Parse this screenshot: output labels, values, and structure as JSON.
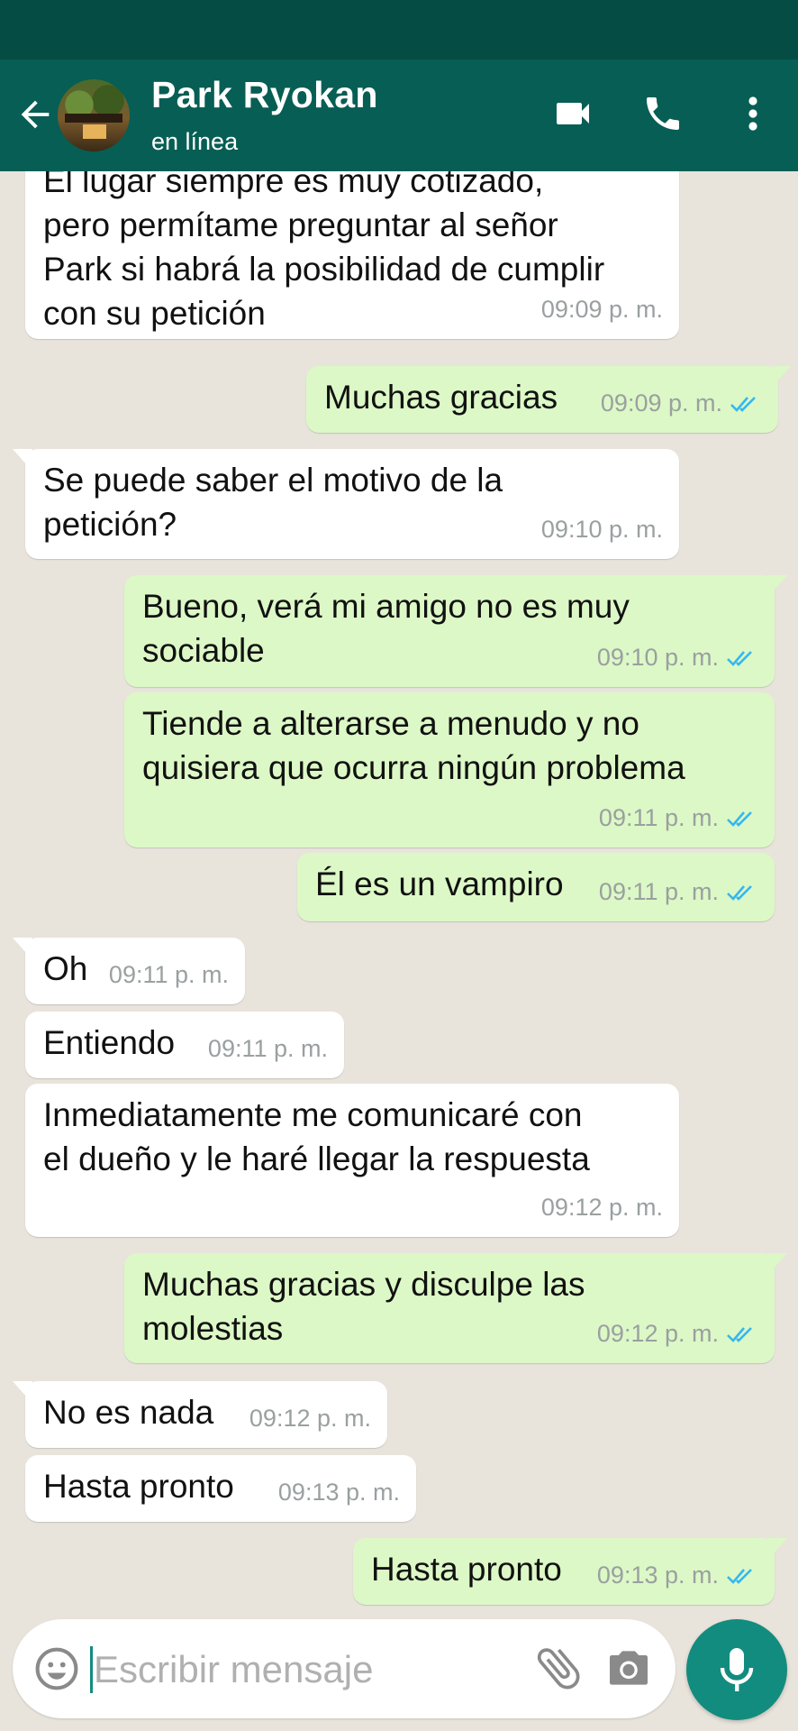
{
  "header": {
    "contact_name": "Park Ryokan",
    "contact_status": "en línea"
  },
  "colors": {
    "header": "#075e54",
    "status_bar": "#054d44",
    "incoming_bubble": "#ffffff",
    "outgoing_bubble": "#dcf8c6",
    "read_ticks": "#34b7f1",
    "mic_button": "#128c7e"
  },
  "messages": [
    {
      "dir": "in",
      "text": "El lugar siempre es muy cotizado,\npero permítame preguntar al señor\nPark si habrá la posibilidad de cumplir\ncon su petición",
      "time": "09:09 p. m."
    },
    {
      "dir": "out",
      "text": "Muchas gracias",
      "time": "09:09 p. m.",
      "status": "read"
    },
    {
      "dir": "in",
      "text": "Se puede saber el motivo de la\npetición?",
      "time": "09:10 p. m."
    },
    {
      "dir": "out",
      "text": "Bueno, verá mi amigo no es muy\nsociable",
      "time": "09:10 p. m.",
      "status": "read"
    },
    {
      "dir": "out",
      "text": "Tiende a alterarse a menudo y no\nquisiera que ocurra ningún problema",
      "time": "09:11 p. m.",
      "status": "read"
    },
    {
      "dir": "out",
      "text": "Él es un vampiro",
      "time": "09:11 p. m.",
      "status": "read"
    },
    {
      "dir": "in",
      "text": "Oh",
      "time": "09:11 p. m."
    },
    {
      "dir": "in",
      "text": "Entiendo",
      "time": "09:11 p. m."
    },
    {
      "dir": "in",
      "text": "Inmediatamente me comunicaré con\nel dueño y le haré llegar la respuesta",
      "time": "09:12 p. m."
    },
    {
      "dir": "out",
      "text": "Muchas gracias y disculpe las\nmolestias",
      "time": "09:12 p. m.",
      "status": "read"
    },
    {
      "dir": "in",
      "text": "No es nada",
      "time": "09:12 p. m."
    },
    {
      "dir": "in",
      "text": "Hasta pronto",
      "time": "09:13 p. m."
    },
    {
      "dir": "out",
      "text": "Hasta pronto",
      "time": "09:13 p. m.",
      "status": "read"
    }
  ],
  "composer": {
    "placeholder": "Escribir mensaje"
  },
  "icons": {
    "back": "back-arrow-icon",
    "video": "video-call-icon",
    "phone": "phone-icon",
    "menu": "more-vert-icon",
    "emoji": "emoji-icon",
    "attach": "paperclip-icon",
    "camera": "camera-icon",
    "mic": "mic-icon"
  }
}
